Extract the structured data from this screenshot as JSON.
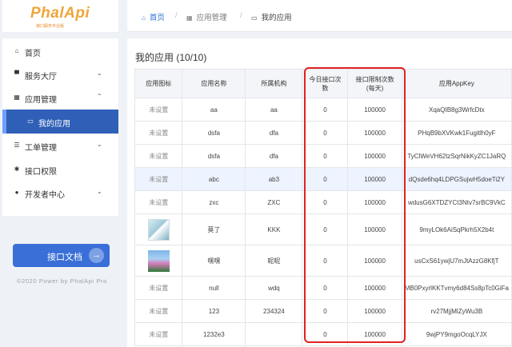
{
  "logo": {
    "text": "PhalApi",
    "subtitle": "接口服务专业版"
  },
  "sidebar": {
    "items": [
      {
        "label": "首页",
        "icon": "home-icon"
      },
      {
        "label": "服务大厅",
        "icon": "cart-icon"
      },
      {
        "label": "应用管理",
        "icon": "grid-icon"
      },
      {
        "label": "我的应用",
        "icon": "folder-icon"
      },
      {
        "label": "工单管理",
        "icon": "list-icon"
      },
      {
        "label": "接口权限",
        "icon": "gear-icon"
      },
      {
        "label": "开发者中心",
        "icon": "user-icon"
      }
    ],
    "doc_button": "接口文档",
    "copyright": "©2020 Power by PhalApi Pro"
  },
  "breadcrumb": {
    "home": "首页",
    "level1": "应用管理",
    "level2": "我的应用"
  },
  "main": {
    "title": "我的应用 (10/10)",
    "columns": [
      "应用图标",
      "应用名称",
      "所属机构",
      "今日接口次数",
      "接口限制次数(每天)",
      "应用AppKey"
    ],
    "col_today_l1": "今日接口次",
    "col_today_l2": "数",
    "col_limit_l1": "接口限制次数",
    "col_limit_l2": "(每天)",
    "rows": [
      {
        "icon": "未设置",
        "name": "aa",
        "org": "aa",
        "today": "0",
        "limit": "100000",
        "appkey": "XqaQIB8g3WrfcDtx"
      },
      {
        "icon": "未设置",
        "name": "dsfa",
        "org": "dfa",
        "today": "0",
        "limit": "100000",
        "appkey": "PHqB9bXVKwk1Fugitlh0yF"
      },
      {
        "icon": "未设置",
        "name": "dsfa",
        "org": "dfa",
        "today": "0",
        "limit": "100000",
        "appkey": "TyClWeVH62tzSqrNikKyZC1JaRQ"
      },
      {
        "icon": "未设置",
        "name": "abc",
        "org": "ab3",
        "today": "0",
        "limit": "100000",
        "appkey": "dQsde6hq4LDPGSujwH5doeTi2Y"
      },
      {
        "icon": "未设置",
        "name": "zxc",
        "org": "ZXC",
        "today": "0",
        "limit": "100000",
        "appkey": "wdusG6XTDZYCt3Ntv7srBC9VkC"
      },
      {
        "icon": "",
        "name": "莫了",
        "org": "KKK",
        "today": "0",
        "limit": "100000",
        "appkey": "9myLOk6AiSqPkrh5X2b4t"
      },
      {
        "icon": "",
        "name": "嘿嘿",
        "org": "呢呢",
        "today": "0",
        "limit": "100000",
        "appkey": "usCxS61ywjU7mJtAzzG8KfjT"
      },
      {
        "icon": "未设置",
        "name": "null",
        "org": "wdq",
        "today": "0",
        "limit": "100000",
        "appkey": "MB0PxyrlKKTvmy6d84Ss8pTc0GiFa"
      },
      {
        "icon": "未设置",
        "name": "123",
        "org": "234324",
        "today": "0",
        "limit": "100000",
        "appkey": "rv27MjjMlZyWu3B"
      },
      {
        "icon": "未设置",
        "name": "1232e3",
        "org": "",
        "today": "0",
        "limit": "100000",
        "appkey": "9wjPY9mgoOcqLYJX"
      }
    ]
  },
  "colors": {
    "accent": "#2f5fb6",
    "button": "#3a6fd8",
    "highlight_box": "#e02222",
    "logo": "#f0a53a"
  }
}
